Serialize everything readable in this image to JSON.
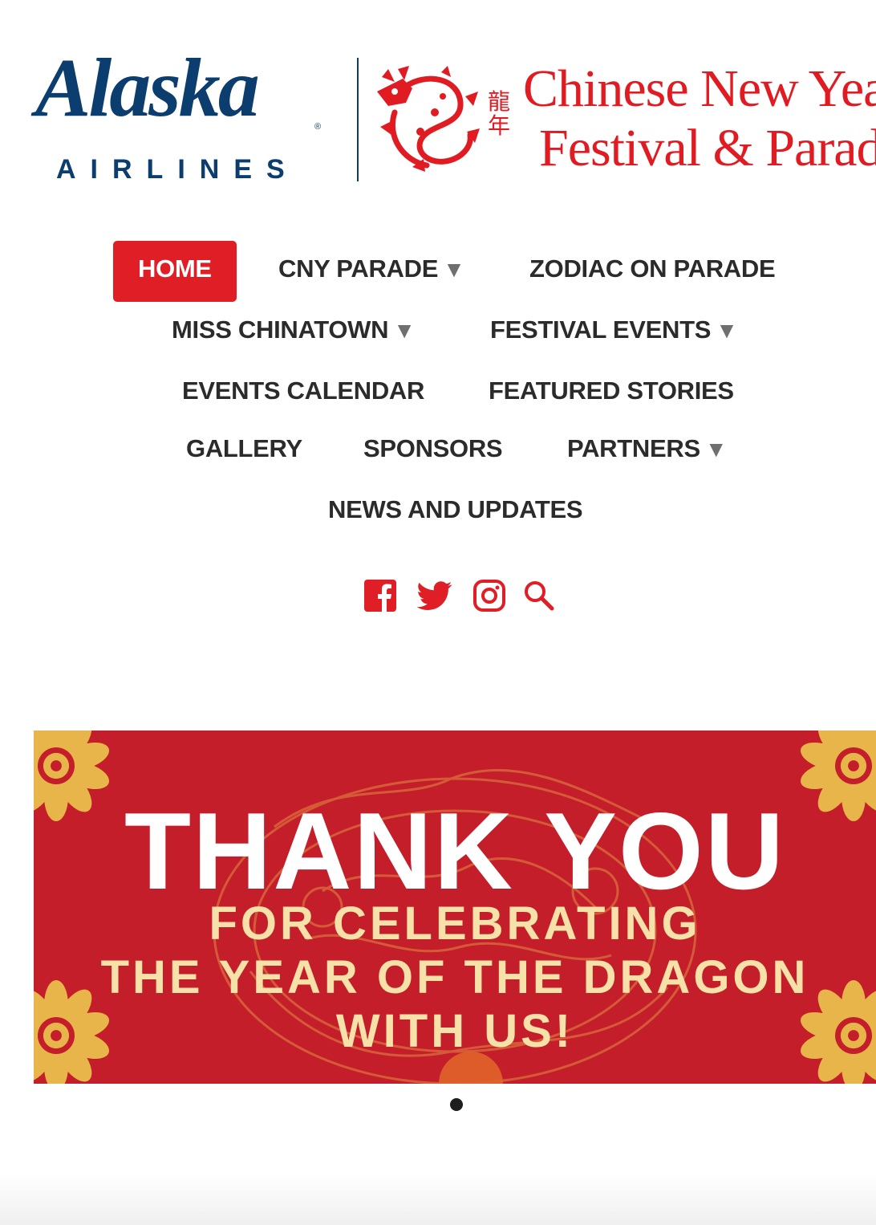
{
  "header": {
    "alaska_logo_text": "Alaska",
    "airlines_text": "AIRLINES",
    "registered_mark": "®",
    "cny_chinese_chars": [
      "龍",
      "年"
    ],
    "cny_title_line1": "Chinese New Year",
    "cny_title_line2": "Festival & Parade",
    "colors": {
      "alaska_blue": "#0b3d6e",
      "cny_red": "#e11b22"
    }
  },
  "nav": {
    "items": [
      {
        "label": "HOME",
        "active": true,
        "has_dropdown": false
      },
      {
        "label": "CNY PARADE",
        "active": false,
        "has_dropdown": true
      },
      {
        "label": "ZODIAC ON PARADE",
        "active": false,
        "has_dropdown": false
      },
      {
        "label": "MISS CHINATOWN",
        "active": false,
        "has_dropdown": true
      },
      {
        "label": "FESTIVAL EVENTS",
        "active": false,
        "has_dropdown": true
      },
      {
        "label": "EVENTS CALENDAR",
        "active": false,
        "has_dropdown": false
      },
      {
        "label": "FEATURED STORIES",
        "active": false,
        "has_dropdown": false
      },
      {
        "label": "GALLERY",
        "active": false,
        "has_dropdown": false
      },
      {
        "label": "SPONSORS",
        "active": false,
        "has_dropdown": false
      },
      {
        "label": "PARTNERS",
        "active": false,
        "has_dropdown": true
      },
      {
        "label": "NEWS AND UPDATES",
        "active": false,
        "has_dropdown": false
      }
    ],
    "dropdown_arrow": "▼",
    "active_color": "#e01e26"
  },
  "social": {
    "icons": [
      "facebook-icon",
      "twitter-icon",
      "instagram-icon",
      "search-icon"
    ],
    "color": "#e01e26"
  },
  "banner": {
    "headline": "THANK YOU",
    "sub_line1": "FOR CELEBRATING",
    "sub_line2": "THE YEAR OF THE DRAGON",
    "sub_line3": "WITH US!",
    "background_color": "#c41e2b",
    "accent_color": "#f6e2a8"
  },
  "carousel": {
    "slide_count": 1,
    "active_index": 0
  }
}
